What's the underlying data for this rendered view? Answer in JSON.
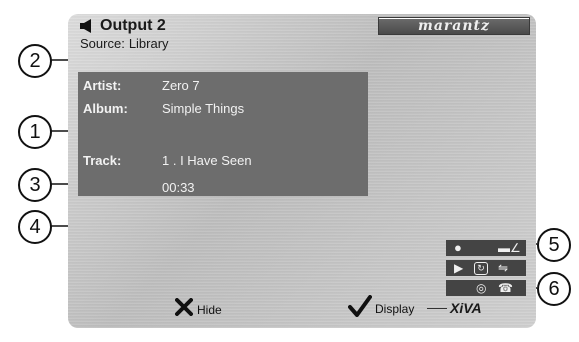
{
  "header": {
    "output_title": "Output 2",
    "source_label": "Source:",
    "source_value": "Library",
    "brand": "marantz"
  },
  "track_info": {
    "artist_label": "Artist:",
    "artist_value": "Zero 7",
    "album_label": "Album:",
    "album_value": "Simple Things",
    "track_label": "Track:",
    "track_value": "1 . I Have Seen",
    "elapsed_time": "00:33"
  },
  "buttons": {
    "hide_label": "Hide",
    "display_label": "Display"
  },
  "footer": {
    "xiva_logo": "XiVA"
  },
  "callouts": {
    "c1": "1",
    "c2": "2",
    "c3": "3",
    "c4": "4",
    "c5": "5",
    "c6": "6"
  },
  "icons": {
    "speaker": "speaker-icon",
    "record_dot": "record-icon",
    "play": "play-icon",
    "repeat": "repeat-icon",
    "shuffle": "shuffle-icon",
    "disc": "disc-icon",
    "phone": "phone-icon",
    "hide": "x-icon",
    "display": "checkmark-icon"
  },
  "colors": {
    "info_panel_bg": "#6d6d6d",
    "panel_text": "#f2f2f2",
    "control_row_bg": "#444444"
  }
}
